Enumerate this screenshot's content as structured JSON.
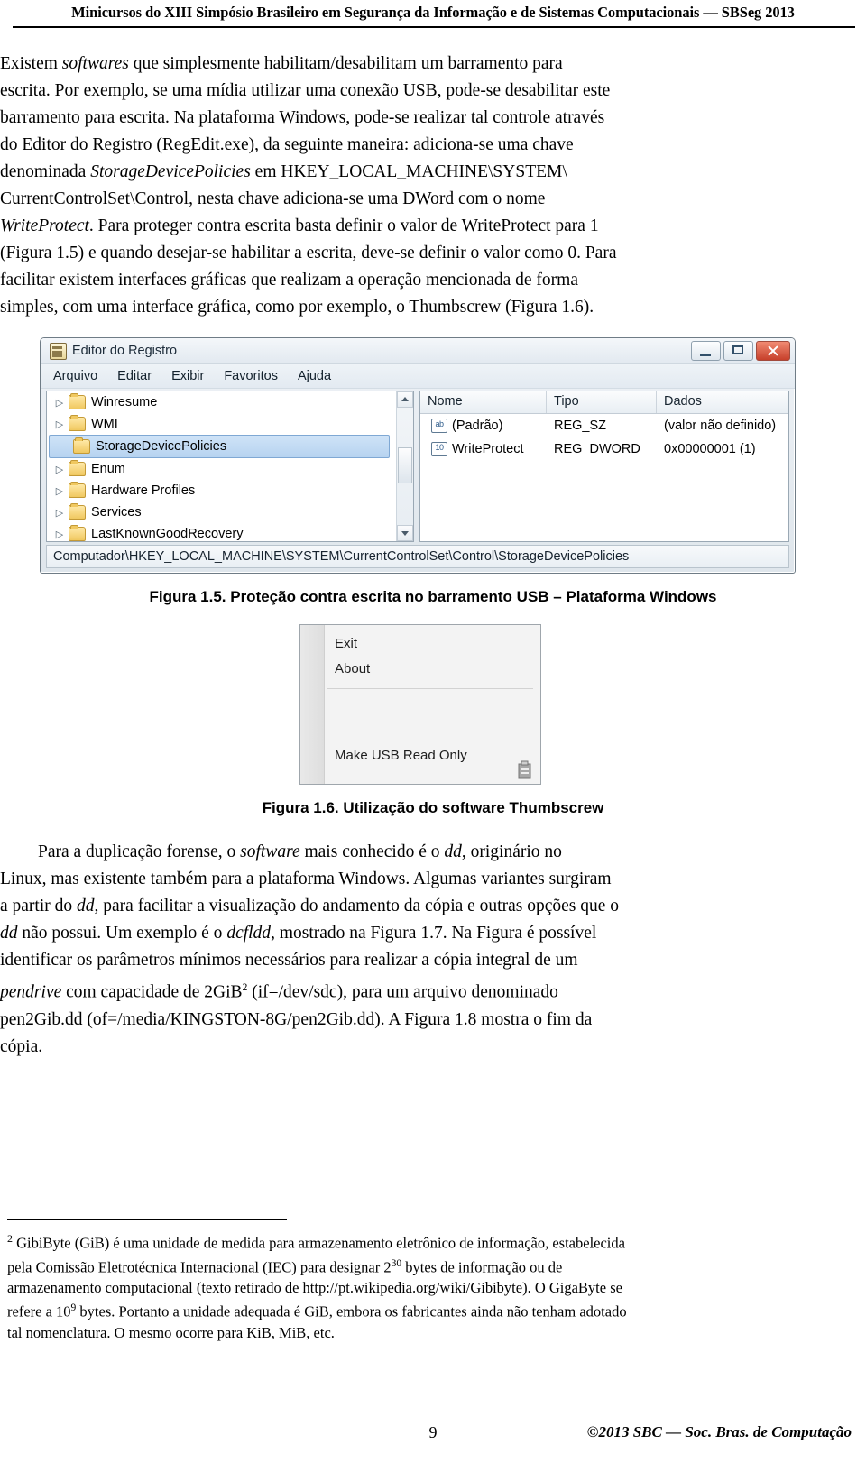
{
  "header": {
    "running_head": "Minicursos do XIII Simpósio Brasileiro em Segurança da Informação e de Sistemas Computacionais — SBSeg 2013"
  },
  "paragraph1": {
    "l1": "Existem ",
    "l1_i": "softwares",
    "l1_b": " que simplesmente habilitam/desabilitam um barramento para",
    "l2": "escrita. Por exemplo, se uma mídia utilizar uma conexão USB, pode-se desabilitar este",
    "l3": "barramento para escrita. Na plataforma Windows, pode-se realizar tal controle através",
    "l4": "do Editor do Registro (RegEdit.exe), da seguinte maneira: adiciona-se uma chave",
    "l5a": "denominada ",
    "l5i": "StorageDevicePolicies",
    "l5b": " em  HKEY_LOCAL_MACHINE\\SYSTEM\\",
    "l6": "CurrentControlSet\\Control, nesta chave adiciona-se uma DWord com o nome",
    "l7i": "WriteProtect",
    "l7b": ". Para proteger contra escrita basta definir o valor de WriteProtect para 1",
    "l8": "(Figura 1.5) e quando desejar-se habilitar a escrita, deve-se definir o valor como 0. Para",
    "l9": "facilitar existem interfaces gráficas que realizam a operação mencionada de forma",
    "l10": "simples, com uma interface gráfica, como por exemplo, o Thumbscrew (Figura 1.6)."
  },
  "figure15": {
    "caption": "Figura 1.5. Proteção contra escrita no barramento USB – Plataforma Windows",
    "window_title": "Editor do Registro",
    "menu": [
      "Arquivo",
      "Editar",
      "Exibir",
      "Favoritos",
      "Ajuda"
    ],
    "tree_nodes": [
      {
        "label": "Winresume",
        "expander": "▷",
        "selected": false
      },
      {
        "label": "WMI",
        "expander": "▷",
        "selected": false
      },
      {
        "label": "StorageDevicePolicies",
        "expander": "",
        "selected": true
      },
      {
        "label": "Enum",
        "expander": "▷",
        "selected": false
      },
      {
        "label": "Hardware Profiles",
        "expander": "▷",
        "selected": false
      },
      {
        "label": "Services",
        "expander": "▷",
        "selected": false
      },
      {
        "label": "LastKnownGoodRecovery",
        "expander": "▷",
        "selected": false
      }
    ],
    "list_headers": [
      "Nome",
      "Tipo",
      "Dados"
    ],
    "list_rows": [
      {
        "icon": "ab",
        "name": "(Padrão)",
        "type": "REG_SZ",
        "data": "(valor não definido)"
      },
      {
        "icon": "10",
        "name": "WriteProtect",
        "type": "REG_DWORD",
        "data": "0x00000001 (1)"
      }
    ],
    "status_path": "Computador\\HKEY_LOCAL_MACHINE\\SYSTEM\\CurrentControlSet\\Control\\StorageDevicePolicies",
    "titlebar_buttons": [
      "minimize",
      "maximize",
      "close"
    ]
  },
  "figure16": {
    "caption": "Figura 1.6. Utilização do software Thumbscrew",
    "menu_items": [
      "Exit",
      "About",
      "Make USB Read Only"
    ]
  },
  "paragraph2": {
    "l1a": "Para a duplicação forense, o ",
    "l1i": "software",
    "l1b": " mais conhecido é o ",
    "l1i2": "dd",
    "l1c": ", originário no",
    "l2": "Linux, mas existente também para a plataforma Windows. Algumas variantes surgiram",
    "l3a": "a partir do ",
    "l3i": "dd",
    "l3b": ", para facilitar a visualização do andamento da cópia e outras opções que o",
    "l4i": "dd",
    "l4a": " não possui. Um exemplo é o ",
    "l4i2": "dcfldd",
    "l4b": ", mostrado na Figura 1.7. Na Figura é possível",
    "l5": "identificar os parâmetros mínimos necessários para realizar a cópia integral de um",
    "l6i": "pendrive",
    "l6a": " com capacidade de 2GiB",
    "l6sup": "2",
    "l6b": " (if=/dev/sdc), para um arquivo denominado",
    "l7": "pen2Gib.dd (of=/media/KINGSTON-8G/pen2Gib.dd). A Figura 1.8 mostra o fim da",
    "l8": "cópia."
  },
  "footnote": {
    "mark": "2",
    "l1": " GibiByte (GiB) é uma unidade de medida para armazenamento eletrônico de informação, estabelecida",
    "l2a": "pela Comissão Eletrotécnica Internacional (IEC) para designar 2",
    "l2sup": "30",
    "l2b": " bytes de informação ou de",
    "l3": "armazenamento computacional (texto retirado de http://pt.wikipedia.org/wiki/Gibibyte). O GigaByte se",
    "l4a": "refere a 10",
    "l4sup": "9",
    "l4b": " bytes. Portanto a unidade adequada é GiB, embora os fabricantes ainda não tenham adotado",
    "l5": "tal nomenclatura. O mesmo ocorre para KiB, MiB, etc."
  },
  "footer": {
    "page_number": "9",
    "copyright": "©2013 SBC — Soc. Bras. de Computação"
  }
}
